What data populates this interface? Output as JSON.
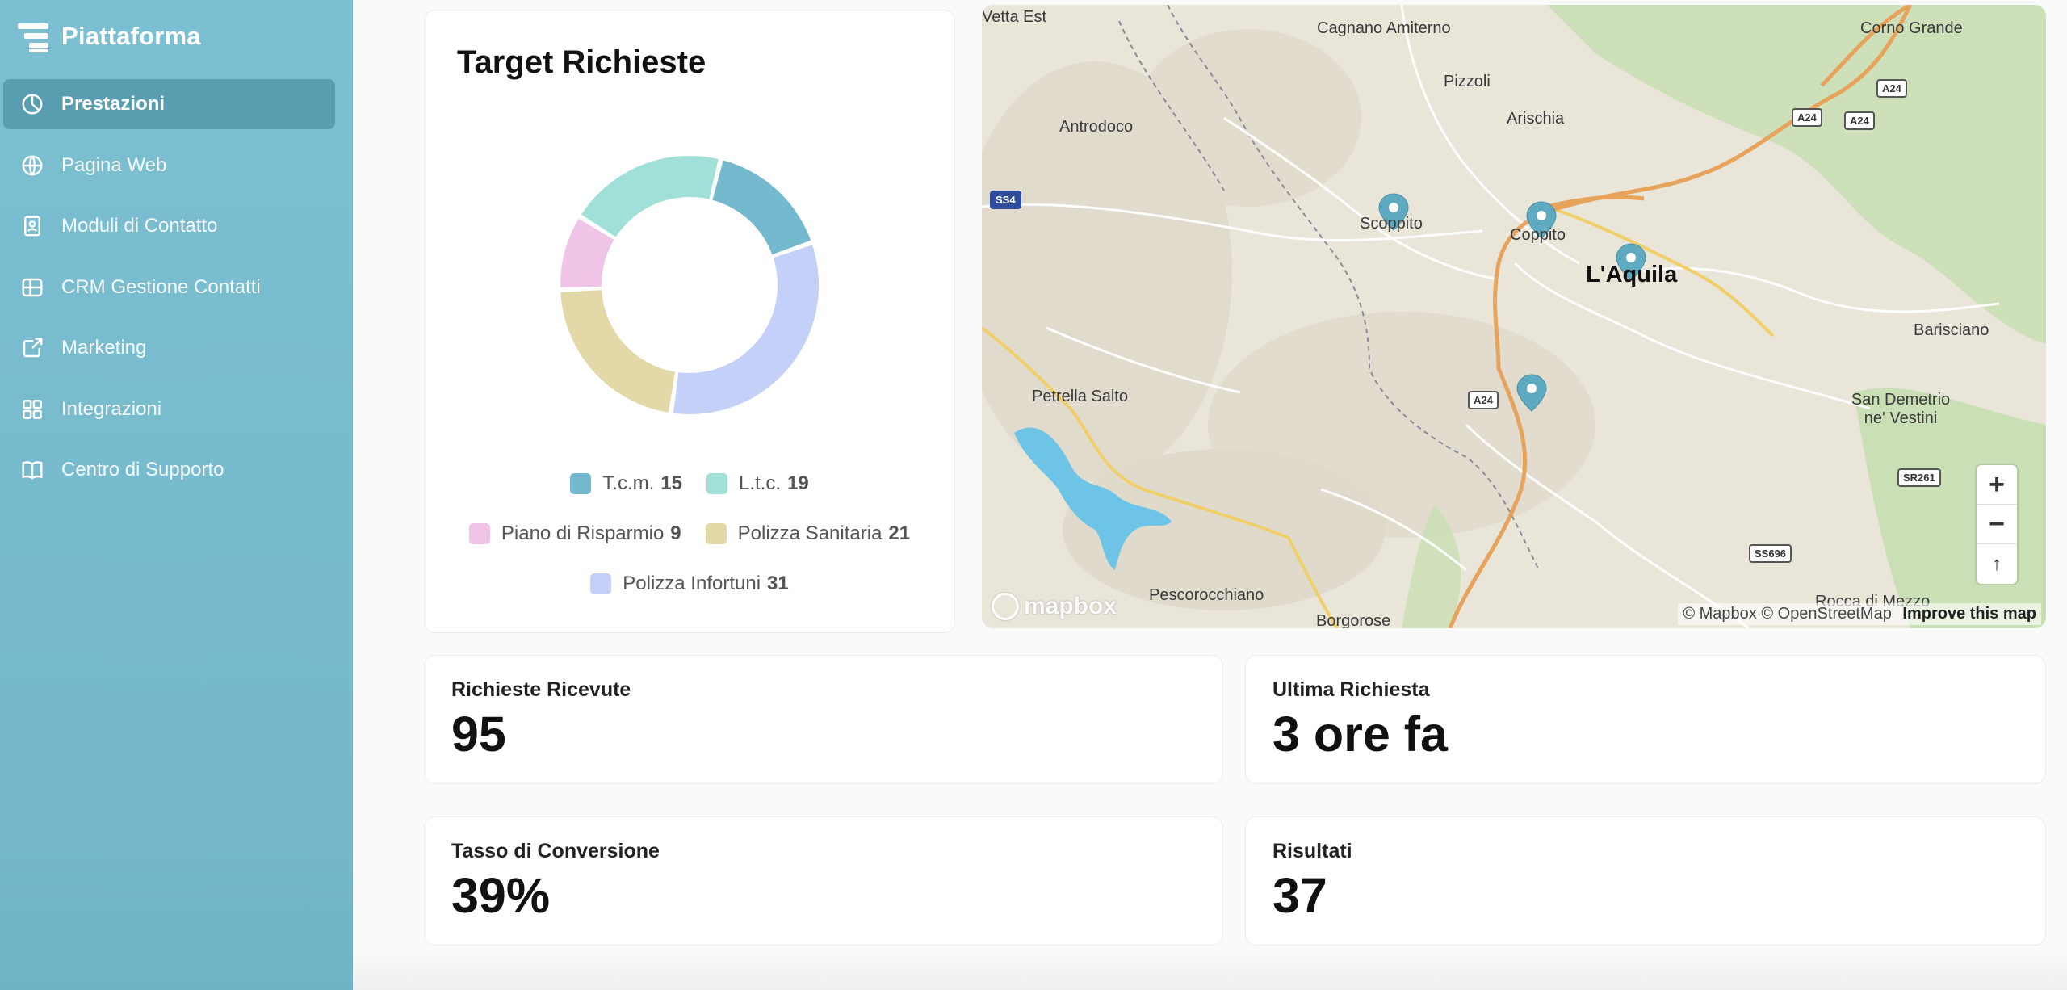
{
  "brand": {
    "title": "Piattaforma"
  },
  "sidebar": {
    "items": [
      {
        "label": "Prestazioni",
        "icon": "pie-chart-icon",
        "active": true
      },
      {
        "label": "Pagina Web",
        "icon": "globe-icon",
        "active": false
      },
      {
        "label": "Moduli di Contatto",
        "icon": "contact-form-icon",
        "active": false
      },
      {
        "label": "CRM Gestione Contatti",
        "icon": "crm-table-icon",
        "active": false
      },
      {
        "label": "Marketing",
        "icon": "share-icon",
        "active": false
      },
      {
        "label": "Integrazioni",
        "icon": "grid-icon",
        "active": false
      },
      {
        "label": "Centro di Supporto",
        "icon": "book-icon",
        "active": false
      }
    ]
  },
  "target": {
    "title": "Target Richieste",
    "legend": [
      {
        "label": "T.c.m.",
        "value": "15",
        "color": "#74b9cd"
      },
      {
        "label": "L.t.c.",
        "value": "19",
        "color": "#a0e0d8"
      },
      {
        "label": "Piano di Risparmio",
        "value": "9",
        "color": "#f0c4e6"
      },
      {
        "label": "Polizza Sanitaria",
        "value": "21",
        "color": "#e3d8a8"
      },
      {
        "label": "Polizza Infortuni",
        "value": "31",
        "color": "#c4d0f8"
      }
    ]
  },
  "chart_data": {
    "type": "pie",
    "title": "Target Richieste",
    "categories": [
      "T.c.m.",
      "L.t.c.",
      "Piano di Risparmio",
      "Polizza Sanitaria",
      "Polizza Infortuni"
    ],
    "values": [
      15,
      19,
      9,
      21,
      31
    ],
    "colors": [
      "#74b9cd",
      "#a0e0d8",
      "#f0c4e6",
      "#e3d8a8",
      "#c4d0f8"
    ],
    "legend": "bottom"
  },
  "map": {
    "places": [
      "Vetta Est",
      "Cagnano Amiterno",
      "Corno Grande",
      "Pizzoli",
      "Antrodoco",
      "Arischia",
      "Scoppito",
      "Coppito",
      "L'Aquila",
      "Barisciano",
      "Petrella Salto",
      "San Demetrio ne' Vestini",
      "Pescorocchiano",
      "Rocca di Mezzo",
      "Borgorose"
    ],
    "roads": [
      "A24",
      "A24",
      "A24",
      "A24",
      "SS4",
      "SR261",
      "SS696"
    ],
    "zoom_in": "+",
    "zoom_out": "−",
    "reset_north": "↑",
    "attribution": "© Mapbox © OpenStreetMap",
    "improve": "Improve this map",
    "logo": "mapbox",
    "marker_color": "#5eaac0"
  },
  "stats": {
    "received": {
      "label": "Richieste Ricevute",
      "value": "95"
    },
    "last": {
      "label": "Ultima Richiesta",
      "value": "3 ore fa"
    },
    "conversion": {
      "label": "Tasso di Conversione",
      "value": "39%"
    },
    "results": {
      "label": "Risultati",
      "value": "37"
    }
  }
}
